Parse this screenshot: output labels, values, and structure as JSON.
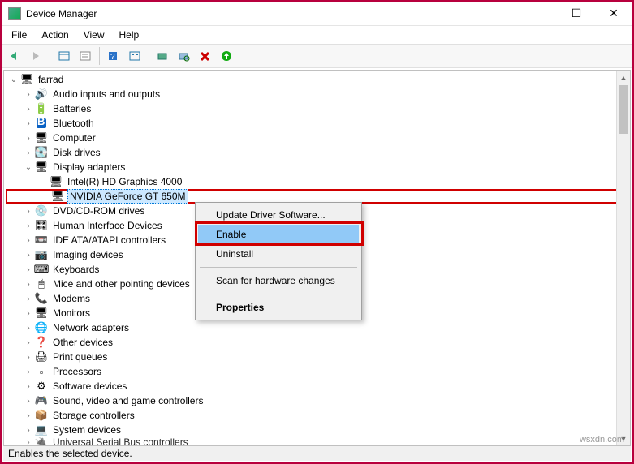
{
  "window": {
    "title": "Device Manager"
  },
  "menubar": [
    "File",
    "Action",
    "View",
    "Help"
  ],
  "toolbar_icons": [
    "back",
    "forward",
    "|",
    "show-hidden",
    "properties",
    "|",
    "help",
    "refresh",
    "|",
    "update-driver",
    "uninstall",
    "disable",
    "delete",
    "scan",
    "enable-arrow"
  ],
  "root": {
    "name": "farrad"
  },
  "tree": [
    {
      "label": "Audio inputs and outputs",
      "icon": "ic-audio",
      "exp": "closed"
    },
    {
      "label": "Batteries",
      "icon": "ic-battery",
      "exp": "closed"
    },
    {
      "label": "Bluetooth",
      "icon": "ic-bt",
      "exp": "closed"
    },
    {
      "label": "Computer",
      "icon": "ic-computer",
      "exp": "closed"
    },
    {
      "label": "Disk drives",
      "icon": "ic-disk",
      "exp": "closed"
    },
    {
      "label": "Display adapters",
      "icon": "ic-display",
      "exp": "open",
      "children": [
        {
          "label": "Intel(R) HD Graphics 4000",
          "icon": "ic-gpu"
        },
        {
          "label": "NVIDIA GeForce GT 650M",
          "icon": "ic-gpu-dis",
          "selected": true,
          "boxed": true
        }
      ]
    },
    {
      "label": "DVD/CD-ROM drives",
      "icon": "ic-dvd",
      "exp": "closed"
    },
    {
      "label": "Human Interface Devices",
      "icon": "ic-hid",
      "exp": "closed"
    },
    {
      "label": "IDE ATA/ATAPI controllers",
      "icon": "ic-ide",
      "exp": "closed"
    },
    {
      "label": "Imaging devices",
      "icon": "ic-img",
      "exp": "closed"
    },
    {
      "label": "Keyboards",
      "icon": "ic-kb",
      "exp": "closed"
    },
    {
      "label": "Mice and other pointing devices",
      "icon": "ic-mouse",
      "exp": "closed"
    },
    {
      "label": "Modems",
      "icon": "ic-modem",
      "exp": "closed"
    },
    {
      "label": "Monitors",
      "icon": "ic-monitor",
      "exp": "closed"
    },
    {
      "label": "Network adapters",
      "icon": "ic-net",
      "exp": "closed"
    },
    {
      "label": "Other devices",
      "icon": "ic-other",
      "exp": "closed"
    },
    {
      "label": "Print queues",
      "icon": "ic-pq",
      "exp": "closed"
    },
    {
      "label": "Processors",
      "icon": "ic-cpu",
      "exp": "closed"
    },
    {
      "label": "Software devices",
      "icon": "ic-soft",
      "exp": "closed"
    },
    {
      "label": "Sound, video and game controllers",
      "icon": "ic-svg",
      "exp": "closed"
    },
    {
      "label": "Storage controllers",
      "icon": "ic-storage",
      "exp": "closed"
    },
    {
      "label": "System devices",
      "icon": "ic-sys",
      "exp": "closed"
    },
    {
      "label": "Universal Serial Bus controllers",
      "icon": "ic-usb",
      "exp": "closed",
      "cut": true
    }
  ],
  "context_menu": {
    "items": [
      {
        "label": "Update Driver Software..."
      },
      {
        "label": "Enable",
        "hover": true
      },
      {
        "label": "Uninstall"
      },
      {
        "sep": true
      },
      {
        "label": "Scan for hardware changes"
      },
      {
        "sep": true
      },
      {
        "label": "Properties",
        "bold": true
      }
    ]
  },
  "statusbar": "Enables the selected device.",
  "watermark": "wsxdn.com"
}
